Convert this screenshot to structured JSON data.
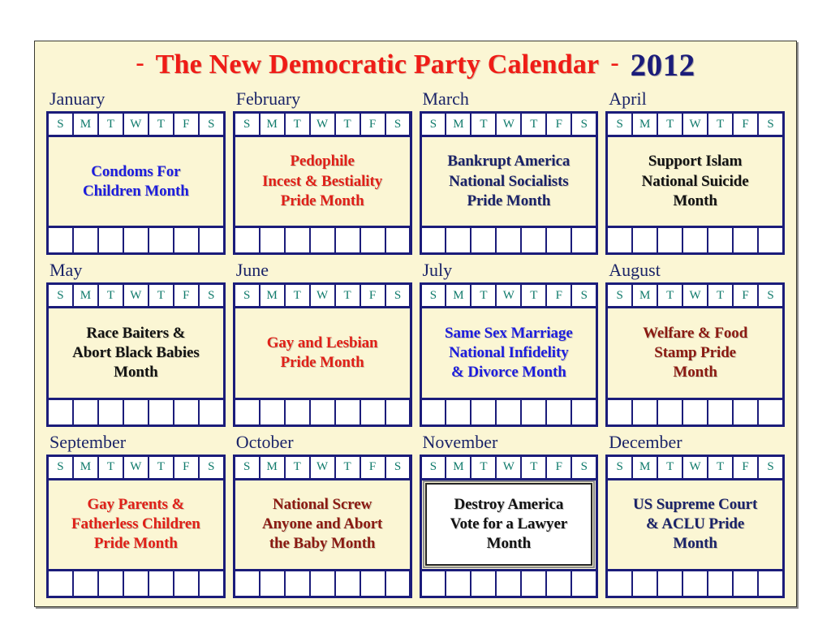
{
  "page": {
    "background_color": "#fbf6d4",
    "border_color": "#3a3a32"
  },
  "header": {
    "left_dash": "-",
    "title": "The New Democratic Party Calendar",
    "right_dash": "-",
    "year": "2012",
    "title_color": "#ef1c16",
    "year_color": "#1b1c7a"
  },
  "day_headers": [
    "S",
    "M",
    "T",
    "W",
    "T",
    "F",
    "S"
  ],
  "day_header_color": "#0f7a6b",
  "grid_border_color": "#1b1c7a",
  "month_label_color": "#1b2468",
  "months": [
    {
      "label": "January",
      "text": "Condoms For\nChildren Month",
      "text_color": "#1d1ddd",
      "boxed": false
    },
    {
      "label": "February",
      "text": "Pedophile\nIncest & Bestiality\nPride Month",
      "text_color": "#e02018",
      "boxed": false
    },
    {
      "label": "March",
      "text": "Bankrupt America\nNational Socialists\nPride Month",
      "text_color": "#1a2268",
      "boxed": false
    },
    {
      "label": "April",
      "text": "Support Islam\nNational Suicide\nMonth",
      "text_color": "#121212",
      "boxed": false
    },
    {
      "label": "May",
      "text": "Race Baiters &\nAbort Black Babies\nMonth",
      "text_color": "#121212",
      "boxed": false
    },
    {
      "label": "June",
      "text": "Gay and Lesbian\nPride Month",
      "text_color": "#e02018",
      "boxed": false
    },
    {
      "label": "July",
      "text": "Same Sex Marriage\nNational Infidelity\n& Divorce Month",
      "text_color": "#1d1ddd",
      "boxed": false
    },
    {
      "label": "August",
      "text": "Welfare & Food\nStamp Pride\nMonth",
      "text_color": "#8b1a12",
      "boxed": false
    },
    {
      "label": "September",
      "text": "Gay Parents &\nFatherless Children\nPride Month",
      "text_color": "#e02018",
      "boxed": false
    },
    {
      "label": "October",
      "text": "National Screw\nAnyone and Abort\nthe Baby Month",
      "text_color": "#8b1a12",
      "boxed": false
    },
    {
      "label": "November",
      "text": "Destroy America\nVote for a Lawyer\nMonth",
      "text_color": "#121212",
      "boxed": true
    },
    {
      "label": "December",
      "text": "US Supreme Court\n& ACLU Pride\nMonth",
      "text_color": "#1a2268",
      "boxed": false
    }
  ]
}
